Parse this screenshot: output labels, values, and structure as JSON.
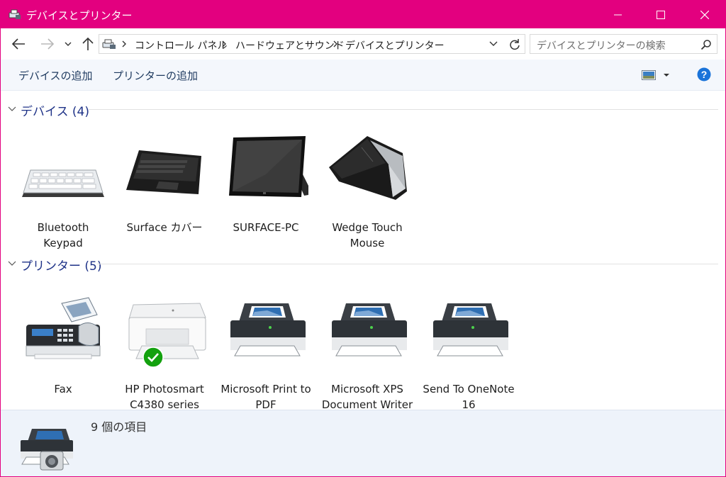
{
  "window": {
    "title": "デバイスとプリンター",
    "accent_color": "#e3007f",
    "icon": "devices-printers-icon"
  },
  "nav": {
    "back_icon": "arrow-left-icon",
    "forward_icon": "arrow-right-icon",
    "recent_icon": "chevron-down-icon",
    "up_icon": "arrow-up-icon"
  },
  "address": {
    "crumbs": [
      "コントロール パネル",
      "ハードウェアとサウンド",
      "デバイスとプリンター"
    ],
    "refresh_icon": "refresh-icon"
  },
  "search": {
    "placeholder": "デバイスとプリンターの検索"
  },
  "commands": {
    "add_device": "デバイスの追加",
    "add_printer": "プリンターの追加",
    "view_icon": "view-options-icon",
    "help_icon": "help-icon"
  },
  "groups": {
    "devices": {
      "title": "デバイス (4)",
      "items": [
        {
          "label_line1": "Bluetooth",
          "label_line2": "Keypad",
          "icon": "keyboard-icon"
        },
        {
          "label_line1": "Surface カバー",
          "label_line2": "",
          "icon": "type-cover-icon"
        },
        {
          "label_line1": "SURFACE-PC",
          "label_line2": "",
          "icon": "tablet-icon"
        },
        {
          "label_line1": "Wedge Touch",
          "label_line2": "Mouse",
          "icon": "mouse-icon"
        }
      ]
    },
    "printers": {
      "title": "プリンター (5)",
      "items": [
        {
          "label_line1": "Fax",
          "label_line2": "",
          "icon": "fax-icon"
        },
        {
          "label_line1": "HP Photosmart",
          "label_line2": "C4380 series",
          "icon": "inkjet-printer-icon",
          "default": true
        },
        {
          "label_line1": "Microsoft Print to",
          "label_line2": "PDF",
          "icon": "printer-icon"
        },
        {
          "label_line1": "Microsoft XPS",
          "label_line2": "Document Writer",
          "icon": "printer-icon"
        },
        {
          "label_line1": "Send To OneNote",
          "label_line2": "16",
          "icon": "printer-icon"
        }
      ]
    }
  },
  "details": {
    "count_text": "9 個の項目",
    "icon": "printer-camera-icon"
  }
}
